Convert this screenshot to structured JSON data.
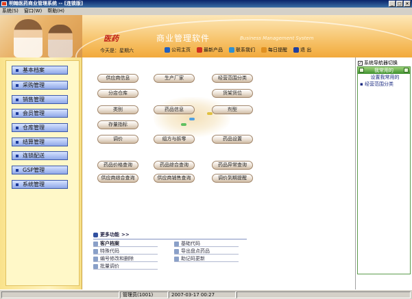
{
  "window": {
    "title": "明翰医药商业管理系统 -- [连锁版]"
  },
  "menu": [
    "系统(S)",
    "窗口(W)",
    "帮助(H)"
  ],
  "header": {
    "logo": "医药",
    "product": "商业管理软件",
    "product_en": "Business Management System",
    "date": "今天是：星期六",
    "links": [
      {
        "label": "公司主页",
        "icon": "home-icon",
        "color": "#2060c0"
      },
      {
        "label": "最新产品",
        "icon": "new-product-icon",
        "color": "#d03020"
      },
      {
        "label": "联系我们",
        "icon": "contact-icon",
        "color": "#3090d0"
      },
      {
        "label": "每日提醒",
        "icon": "reminder-icon",
        "color": "#e09020"
      },
      {
        "label": "退 出",
        "icon": "exit-icon",
        "color": "#2040a0"
      }
    ]
  },
  "nav": [
    "基本档案",
    "采购管理",
    "销售管理",
    "会员管理",
    "仓库管理",
    "结算管理",
    "连锁配送",
    "GSP管理",
    "系统管理"
  ],
  "functions": {
    "supplier": "供应商信息",
    "manufacturer": "生产厂家",
    "business_scope": "经营范围分类",
    "branch_warehouse": "分店仓库",
    "shelf": "货架货位",
    "category": "类别",
    "drug_info": "药品信息",
    "dosage_form": "剂型",
    "stock_indicator": "存量指标",
    "price_adjust": "调价",
    "combine_split": "组方与拆零",
    "drug_settings": "药品设置",
    "drug_price_query": "药品价格查询",
    "drug_general_query": "药品综合查询",
    "drug_abnormal_query": "药品异常查询",
    "supplier_general_query": "供应商综合查询",
    "supplier_sales_query": "供应商销售查询",
    "price_expire_reminder": "调价到期提醒"
  },
  "more": {
    "title": "更多功能",
    "arrow": ">>",
    "left": [
      "客户档案",
      "特殊代码",
      "编号修改和删除",
      "批量调价"
    ],
    "right": [
      "基础代码",
      "导出盘点药品",
      "助记码更新"
    ]
  },
  "right": {
    "toggle_label": "系统导航器切换",
    "toggle_checked": "✓",
    "panel_title": "我常用的",
    "items": [
      "设置我常用的",
      "经营范围分类"
    ]
  },
  "status": {
    "user": "管理员(1001)",
    "datetime": "2007-03-17 00:27"
  }
}
